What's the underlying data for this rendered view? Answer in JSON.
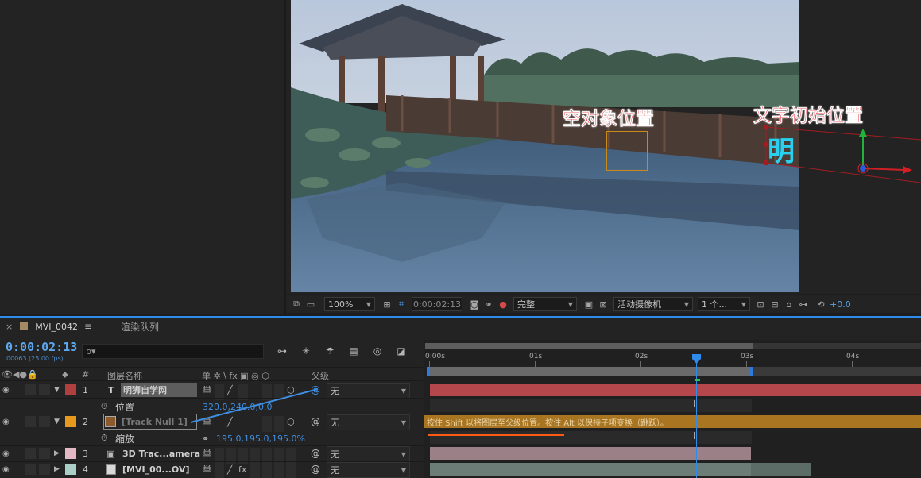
{
  "viewer": {
    "annotation_null": "空对象位置",
    "annotation_text": "文字初始位置",
    "text_layer_glyph": "明",
    "toolbar": {
      "zoom": "100%",
      "timecode": "0:00:02:13",
      "resolution": "完整",
      "camera": "活动摄像机",
      "views": "1 个...",
      "exposure": "+0.0"
    }
  },
  "timeline": {
    "tab_label": "MVI_0042",
    "render_queue": "渲染队列",
    "current_time": "0:00:02:13",
    "frame_info": "00063 (25.00 fps)",
    "search_placeholder": "ρ▾",
    "columns": {
      "hash": "#",
      "layer_name": "图层名称",
      "parent": "父级",
      "switches": "单 ✲ \\ fx ▣ ◎ ⬡"
    },
    "ruler": [
      "0:00s",
      "01s",
      "02s",
      "03s",
      "04s"
    ],
    "layers": [
      {
        "index": "1",
        "type_icon": "T",
        "name": "明狮自学网",
        "color": "#b0403f",
        "parent": "无"
      },
      {
        "prop": "位置",
        "value": "320.0,240.0,0.0"
      },
      {
        "index": "2",
        "type_icon": "",
        "name": "[Track Null 1]",
        "color": "#e89a1f",
        "parent": "无"
      },
      {
        "prop": "缩放",
        "value": "195.0,195.0,195.0%"
      },
      {
        "index": "3",
        "type_icon": "cam",
        "name": "3D Trac...amera",
        "color": "#e2b9c4",
        "parent": "无"
      },
      {
        "index": "4",
        "type_icon": "footage",
        "name": "[MVI_00...OV]",
        "color": "#a9cfc6",
        "parent": "无"
      }
    ],
    "tip": "按住 Shift 以将图层至父级位置。按住 Alt 以保持子项变换（跳跃）。"
  },
  "colors": {
    "accent": "#2d8ceb",
    "annotation": "#e8242c",
    "layer_red": "#b4474c",
    "layer_orange": "#a97520"
  }
}
